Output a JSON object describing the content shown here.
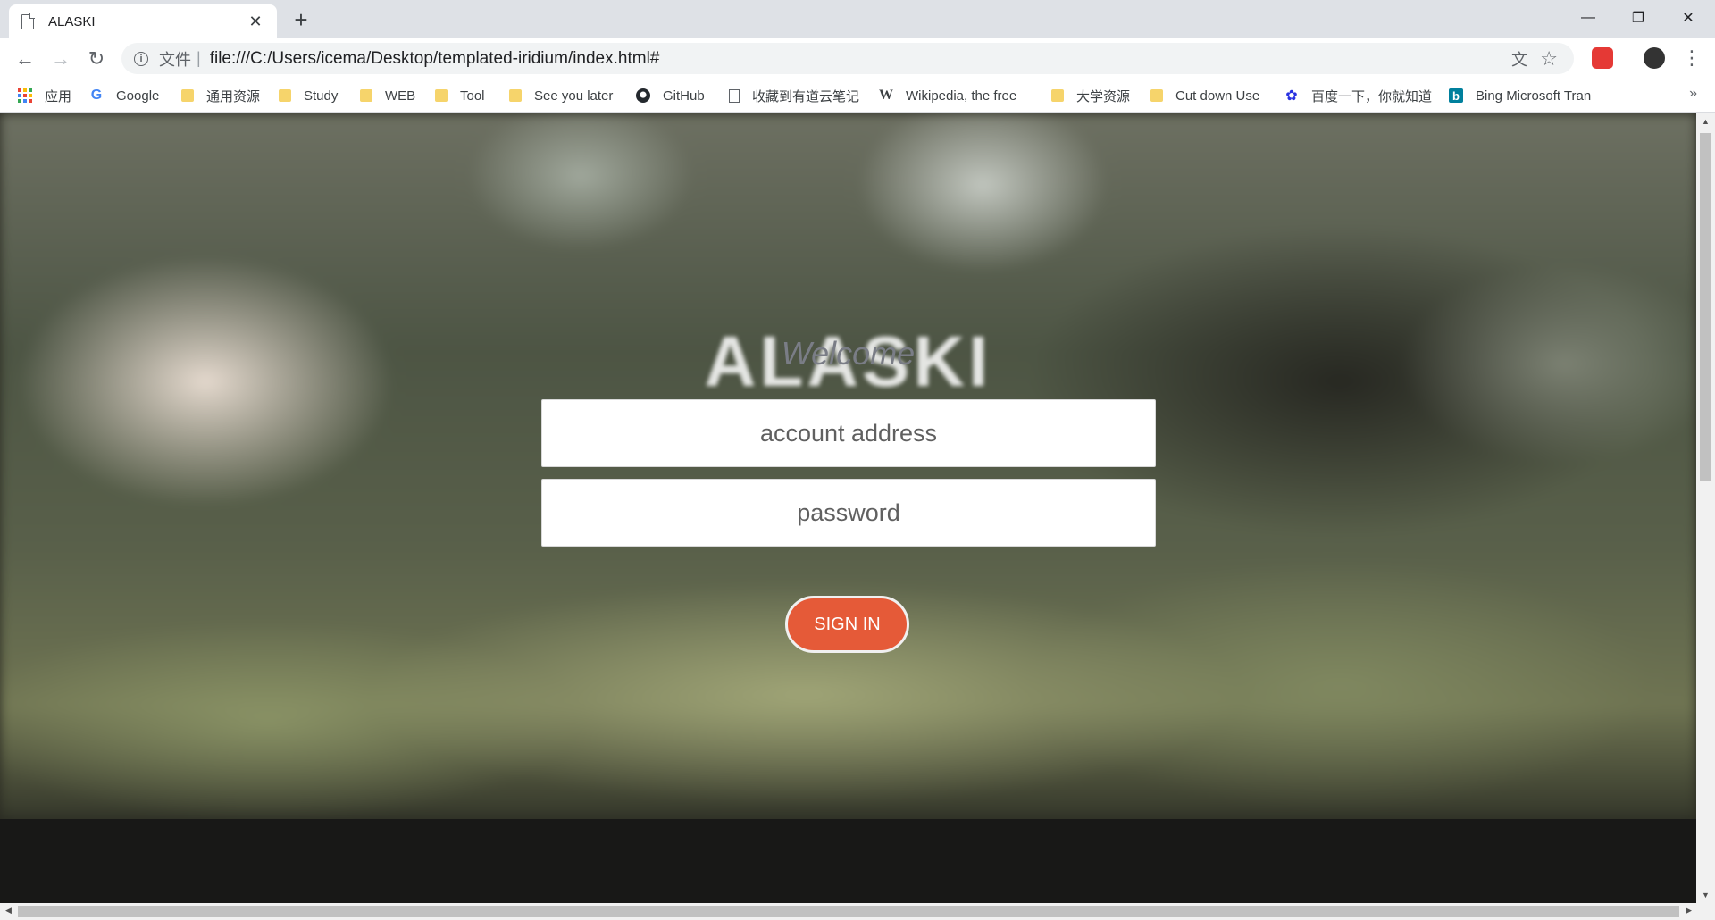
{
  "browser": {
    "tab": {
      "title": "ALASKI",
      "close_glyph": "✕"
    },
    "new_tab_glyph": "+",
    "window_controls": {
      "minimize": "—",
      "maximize": "❐",
      "close": "✕"
    },
    "toolbar": {
      "back_glyph": "←",
      "forward_glyph": "→",
      "reload_glyph": "↻",
      "info_glyph": "i",
      "scheme_label": "文件",
      "separator": "|",
      "url": "file:///C:/Users/icema/Desktop/templated-iridium/index.html#",
      "translate_glyph": "文",
      "star_glyph": "☆",
      "menu_glyph": "⋮"
    },
    "bookmarks": [
      {
        "label": "应用",
        "icon": "apps-icon"
      },
      {
        "label": "Google",
        "icon": "google-icon"
      },
      {
        "label": "通用资源",
        "icon": "folder-icon"
      },
      {
        "label": "Study",
        "icon": "folder-icon"
      },
      {
        "label": "WEB",
        "icon": "folder-icon"
      },
      {
        "label": "Tool",
        "icon": "folder-icon"
      },
      {
        "label": "See you later",
        "icon": "folder-icon"
      },
      {
        "label": "GitHub",
        "icon": "github-icon"
      },
      {
        "label": "收藏到有道云笔记",
        "icon": "document-icon"
      },
      {
        "label": "Wikipedia, the free",
        "icon": "wikipedia-icon"
      },
      {
        "label": "大学资源",
        "icon": "folder-icon"
      },
      {
        "label": "Cut down Use",
        "icon": "folder-icon"
      },
      {
        "label": "百度一下，你就知道",
        "icon": "baidu-icon"
      },
      {
        "label": "Bing Microsoft Tran",
        "icon": "bing-icon"
      }
    ],
    "bookmarks_more_glyph": "»"
  },
  "page": {
    "background_title": "ALASKI",
    "welcome_text": "Welcome",
    "account_placeholder": "account address",
    "password_placeholder": "password",
    "signin_label": "SIGN IN",
    "colors": {
      "signin_button": "#e55a38",
      "field_background": "#ffffff",
      "welcome_text": "#7a7d86"
    }
  },
  "scrollbars": {
    "up_glyph": "▲",
    "down_glyph": "▼",
    "left_glyph": "◀",
    "right_glyph": "▶"
  }
}
